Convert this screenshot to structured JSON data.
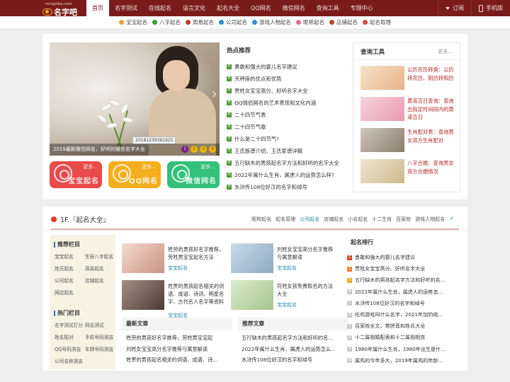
{
  "header": {
    "logo_url": "mingziba.com",
    "logo_name": "名字吧",
    "nav": [
      "首页",
      "名字测试",
      "在线起名",
      "语言文化",
      "起名大全",
      "QQ网名",
      "微信网名",
      "查询工具",
      "专题中心"
    ],
    "subscribe": "订阅",
    "mobile": "手机版"
  },
  "subnav": [
    {
      "label": "宝宝起名",
      "color": "#e8a431"
    },
    {
      "label": "八字起名",
      "color": "#3a9b3a"
    },
    {
      "label": "周易起名",
      "color": "#c2372d"
    },
    {
      "label": "公司起名",
      "color": "#2b8fd0"
    },
    {
      "label": "游戏人物起名",
      "color": "#2b8fd0"
    },
    {
      "label": "昵称起名",
      "color": "#e36a8f"
    },
    {
      "label": "店铺起名",
      "color": "#b4472f"
    },
    {
      "label": "起名取理",
      "color": "#d64a3a"
    }
  ],
  "slider": {
    "caption": "2019最新微信网名，好听的微信名字大全",
    "tag": "20181239361925",
    "dots": [
      "1",
      "2",
      "3",
      "4"
    ],
    "active_dot": 1
  },
  "quick_buttons": [
    {
      "label": "宝宝起名",
      "more": "更多...",
      "color": "#e94a4a"
    },
    {
      "label": "QQ网名",
      "more": "更多...",
      "color": "#f5ae1e"
    },
    {
      "label": "微信网名",
      "more": "更多...",
      "color": "#33c07a"
    }
  ],
  "hot": {
    "title": "热点推荐",
    "items": [
      "勇敢和强大的婴儿名字建议",
      "天秤座的优点和优势",
      "贾姓女宝宝高分、好听名字大全",
      "QQ情侣网名的艺术表现和文化内涵",
      "二十四节气表",
      "二十四节气歌",
      "什么是二十四节气?",
      "王氏族谱介绍，王氏家谱详解",
      "五行缺木的男孩起名字方法和好听的名字大全",
      "2022年属什么生肖，属虎人的运势怎么样?",
      "水浒传108位好汉的名字和绰号"
    ]
  },
  "tools": {
    "title": "查询工具",
    "more": "更多...",
    "items": [
      "公历农历转换：公历转农历、阴历转阳历",
      "黄道吉日查询：查询出指定时间段内的黄道吉日",
      "生肖配对表：查询男女双方生肖配对",
      "八字合婚：查询男女双方合婚情况"
    ]
  },
  "section": {
    "title": "1F.『起名大全』",
    "tabs": [
      "昵称起名",
      "起名原理",
      "公司起名",
      "店铺起名",
      "小名起名",
      "十二生肖",
      "百家姓",
      "游戏人物起名"
    ],
    "active_tab": 2,
    "recommend_title": "推荐栏目",
    "recommend_items": [
      "宝宝起名",
      "生辰八字起名",
      "姓氏起名",
      "周易起名",
      "公司起名",
      "店铺起名",
      "网店起名"
    ],
    "hot_title": "热门栏目",
    "hot_items": [
      "名字测试打分",
      "网名测试",
      "姓名配对",
      "手机号码测吉",
      "QQ号码测吉",
      "车牌号码测吉",
      "公司名称测吉"
    ],
    "articles": [
      {
        "title": "姓劳的男孩好名字推荐，劳姓男宝宝起名方法",
        "cat": "宝宝起名"
      },
      {
        "title": "刘姓女宝宝高分名字推荐与寓意解读",
        "cat": "宝宝起名"
      },
      {
        "title": "姓贾的男孩起名相关的词语、成语、诗词、明星名字、古代名人名字等资料",
        "cat": "宝宝起名"
      },
      {
        "title": "符姓女孩免费取名的方法大全",
        "cat": "宝宝起名"
      }
    ],
    "latest_title": "最新文章",
    "latest": [
      "姓劳的男孩好名字推荐，劳姓男宝宝起",
      "刘姓女宝宝高分名字推荐与寓意解读",
      "姓贾的男孩起名相关的词语、成语、诗..."
    ],
    "recommend_articles_title": "推荐文章",
    "recommend_articles": [
      "五行缺木的男孩起名字方法和好听的名...",
      "2022年属什么生肖，属虎人的运势怎么...",
      "水浒传108位好汉的名字和绰号"
    ],
    "rank_title": "起名排行",
    "rank": [
      "勇敢和强大的婴儿名字建议",
      "贾姓女宝宝高分、好听名字大全",
      "五行缺木的男孩起名字方法和好听的名...",
      "2022年属什么生肖，属虎人的运势怎...",
      "水浒传108位好汉的名字和绰号",
      "吃鸡游戏叫什么名字，2021年加钓络...",
      "百家姓全文，带拼音和姓氏大全",
      "十二属相婚配表和十二属相相克",
      "1980年属什么生肖，1980年出生是什...",
      "属鸡的今年多大，2019年属鸡的年龄..."
    ]
  }
}
